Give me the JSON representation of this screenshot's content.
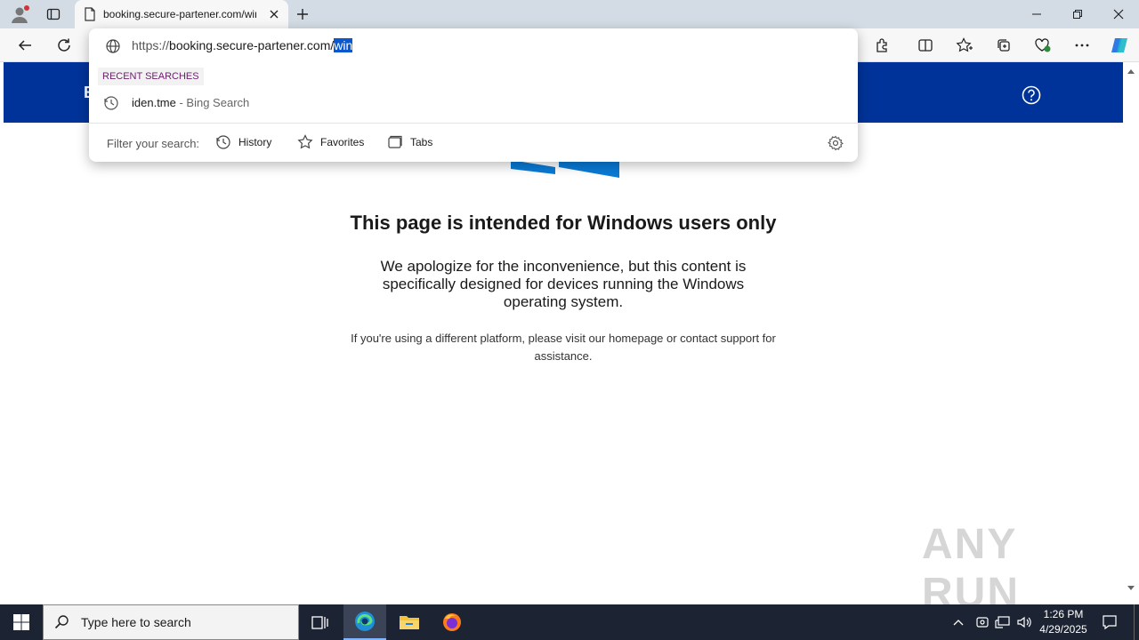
{
  "browser": {
    "tab_title": "booking.secure-partener.com/win",
    "address": {
      "scheme": "https://",
      "host": "booking.secure-partener.com/",
      "selected": "win"
    }
  },
  "omnibox": {
    "recent_label": "RECENT SEARCHES",
    "suggestion": {
      "query": "iden.tme",
      "source": " - Bing Search"
    },
    "filter_label": "Filter your search:",
    "filters": [
      {
        "label": "History",
        "icon": "history-icon"
      },
      {
        "label": "Favorites",
        "icon": "star-icon"
      },
      {
        "label": "Tabs",
        "icon": "tabs-icon"
      }
    ]
  },
  "site": {
    "header_brand": "E",
    "header_color": "#003399",
    "heading": "This page is intended for Windows users only",
    "lead": "We apologize for the inconvenience, but this content is specifically designed for devices running the Windows operating system.",
    "note": "If you're using a different platform, please visit our homepage or contact support for assistance."
  },
  "watermark": "ANY RUN",
  "taskbar": {
    "search_placeholder": "Type here to search",
    "time": "1:26 PM",
    "date": "4/29/2025"
  },
  "colors": {
    "accent": "#0b57d0",
    "tabstrip": "#d3dbe4",
    "taskbar": "#1c2434"
  }
}
